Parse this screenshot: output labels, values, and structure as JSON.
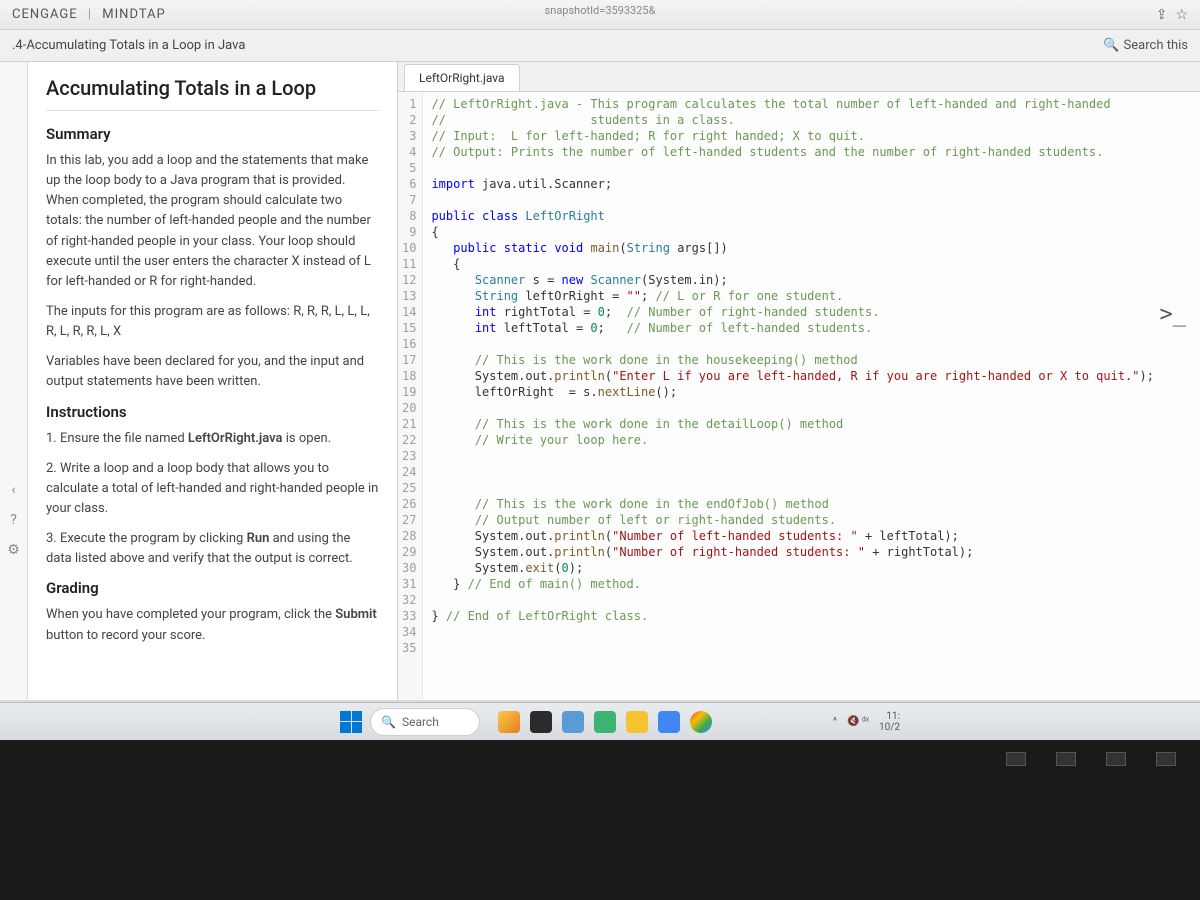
{
  "brand": {
    "left": "CENGAGE",
    "right": "MINDTAP"
  },
  "url_fragment": "snapshotId=3593325&",
  "breadcrumb": ".4-Accumulating Totals in a Loop in Java",
  "search_this": "Search this",
  "page_title": "Accumulating Totals in a Loop",
  "sidebar": {
    "summary_heading": "Summary",
    "summary_p1": "In this lab, you add a loop and the statements that make up the loop body to a Java program that is provided. When completed, the program should calculate two totals: the number of left-handed people and the number of right-handed people in your class. Your loop should execute until the user enters the character X instead of L for left-handed or R for right-handed.",
    "summary_p2": "The inputs for this program are as follows: R, R, R, L, L, L, R, L, R, R, L, X",
    "summary_p3": "Variables have been declared for you, and the input and output statements have been written.",
    "instructions_heading": "Instructions",
    "step1_pre": "1. Ensure the file named ",
    "step1_bold": "LeftOrRight.java",
    "step1_post": " is open.",
    "step2": "2. Write a loop and a loop body that allows you to calculate a total of left-handed and right-handed people in your class.",
    "step3_pre": "3. Execute the program by clicking ",
    "step3_bold": "Run",
    "step3_post": " and using the data listed above and verify that the output is correct.",
    "grading_heading": "Grading",
    "grading_p_pre": "When you have completed your program, click the ",
    "grading_p_bold": "Submit",
    "grading_p_post": " button to record your score."
  },
  "editor": {
    "tab": "LeftOrRight.java",
    "lines": [
      {
        "n": 1,
        "html": "<span class='tok-comment'>// LeftOrRight.java - This program calculates the total number of left-handed and right-handed</span>"
      },
      {
        "n": 2,
        "html": "<span class='tok-comment'>//                    students in a class.</span>"
      },
      {
        "n": 3,
        "html": "<span class='tok-comment'>// Input:  L for left-handed; R for right handed; X to quit.</span>"
      },
      {
        "n": 4,
        "html": "<span class='tok-comment'>// Output: Prints the number of left-handed students and the number of right-handed students.</span>"
      },
      {
        "n": 5,
        "html": ""
      },
      {
        "n": 6,
        "html": "<span class='tok-keyword'>import</span> java.util.Scanner;"
      },
      {
        "n": 7,
        "html": ""
      },
      {
        "n": 8,
        "html": "<span class='tok-keyword'>public</span> <span class='tok-keyword'>class</span> <span class='tok-class'>LeftOrRight</span>"
      },
      {
        "n": 9,
        "html": "{"
      },
      {
        "n": 10,
        "html": "   <span class='tok-keyword'>public</span> <span class='tok-keyword'>static</span> <span class='tok-keyword'>void</span> <span class='tok-method'>main</span>(<span class='tok-type'>String</span> args[])"
      },
      {
        "n": 11,
        "html": "   {"
      },
      {
        "n": 12,
        "html": "      <span class='tok-type'>Scanner</span> s = <span class='tok-keyword'>new</span> <span class='tok-type'>Scanner</span>(System.in);"
      },
      {
        "n": 13,
        "html": "      <span class='tok-type'>String</span> leftOrRight = <span class='tok-string'>\"\"</span>; <span class='tok-comment'>// L or R for one student.</span>"
      },
      {
        "n": 14,
        "html": "      <span class='tok-keyword'>int</span> rightTotal = <span class='tok-number'>0</span>;  <span class='tok-comment'>// Number of right-handed students.</span>"
      },
      {
        "n": 15,
        "html": "      <span class='tok-keyword'>int</span> leftTotal = <span class='tok-number'>0</span>;   <span class='tok-comment'>// Number of left-handed students.</span>"
      },
      {
        "n": 16,
        "html": ""
      },
      {
        "n": 17,
        "html": "      <span class='tok-comment'>// This is the work done in the housekeeping() method</span>"
      },
      {
        "n": 18,
        "html": "      System.out.<span class='tok-method'>println</span>(<span class='tok-string'>\"Enter L if you are left-handed, R if you are right-handed or X to quit.\"</span>);"
      },
      {
        "n": 19,
        "html": "      leftOrRight  = s.<span class='tok-method'>nextLine</span>();"
      },
      {
        "n": 20,
        "html": ""
      },
      {
        "n": 21,
        "html": "      <span class='tok-comment'>// This is the work done in the detailLoop() method</span>"
      },
      {
        "n": 22,
        "html": "      <span class='tok-comment'>// Write your loop here.</span>"
      },
      {
        "n": 23,
        "html": ""
      },
      {
        "n": 24,
        "html": ""
      },
      {
        "n": 25,
        "html": ""
      },
      {
        "n": 26,
        "html": "      <span class='tok-comment'>// This is the work done in the endOfJob() method</span>"
      },
      {
        "n": 27,
        "html": "      <span class='tok-comment'>// Output number of left or right-handed students.</span>"
      },
      {
        "n": 28,
        "html": "      System.out.<span class='tok-method'>println</span>(<span class='tok-string'>\"Number of left-handed students: \"</span> + leftTotal);"
      },
      {
        "n": 29,
        "html": "      System.out.<span class='tok-method'>println</span>(<span class='tok-string'>\"Number of right-handed students: \"</span> + rightTotal);"
      },
      {
        "n": 30,
        "html": "      System.<span class='tok-method'>exit</span>(<span class='tok-number'>0</span>);"
      },
      {
        "n": 31,
        "html": "   } <span class='tok-comment'>// End of main() method.</span>"
      },
      {
        "n": 32,
        "html": ""
      },
      {
        "n": 33,
        "html": "} <span class='tok-comment'>// End of LeftOrRight class.</span>"
      },
      {
        "n": 34,
        "html": ""
      },
      {
        "n": 35,
        "html": ""
      }
    ]
  },
  "taskbar": {
    "search": "Search",
    "time": "11:",
    "date": "10/2"
  },
  "terminal_glyph": ">_"
}
